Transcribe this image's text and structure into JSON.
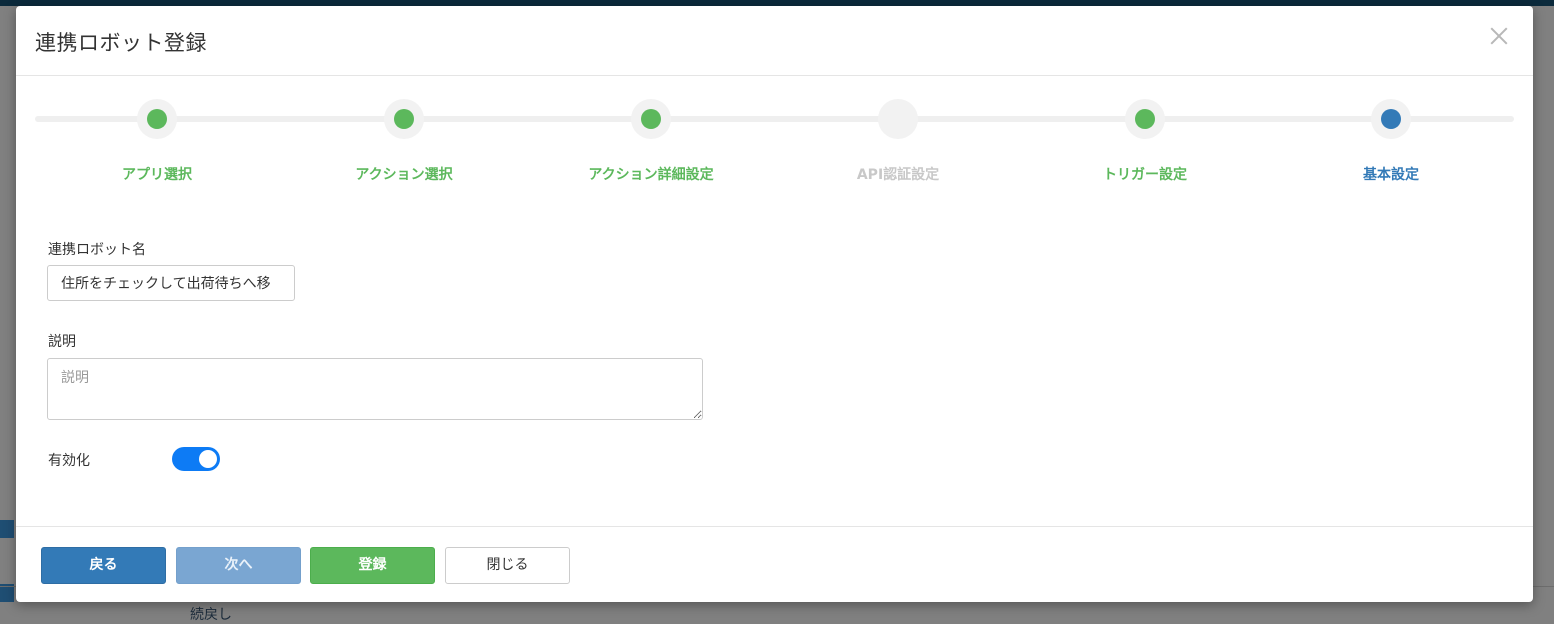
{
  "modal": {
    "title": "連携ロボット登録"
  },
  "stepper": {
    "steps": [
      {
        "label": "アプリ選択",
        "state": "done"
      },
      {
        "label": "アクション選択",
        "state": "done"
      },
      {
        "label": "アクション詳細設定",
        "state": "done"
      },
      {
        "label": "API認証設定",
        "state": "skipped"
      },
      {
        "label": "トリガー設定",
        "state": "done"
      },
      {
        "label": "基本設定",
        "state": "current"
      }
    ]
  },
  "form": {
    "robot_name_label": "連携ロボット名",
    "robot_name_value": "住所をチェックして出荷待ちへ移",
    "description_label": "説明",
    "description_placeholder": "説明",
    "enable_label": "有効化",
    "enabled": true
  },
  "footer": {
    "back_label": "戻る",
    "next_label": "次へ",
    "register_label": "登録",
    "close_label": "閉じる"
  },
  "background": {
    "bottom_text": "続戻し"
  },
  "colors": {
    "done": "#5cb85c",
    "current": "#337ab7",
    "skipped": "#c8c8c8",
    "toggle": "#0d7bf5"
  }
}
